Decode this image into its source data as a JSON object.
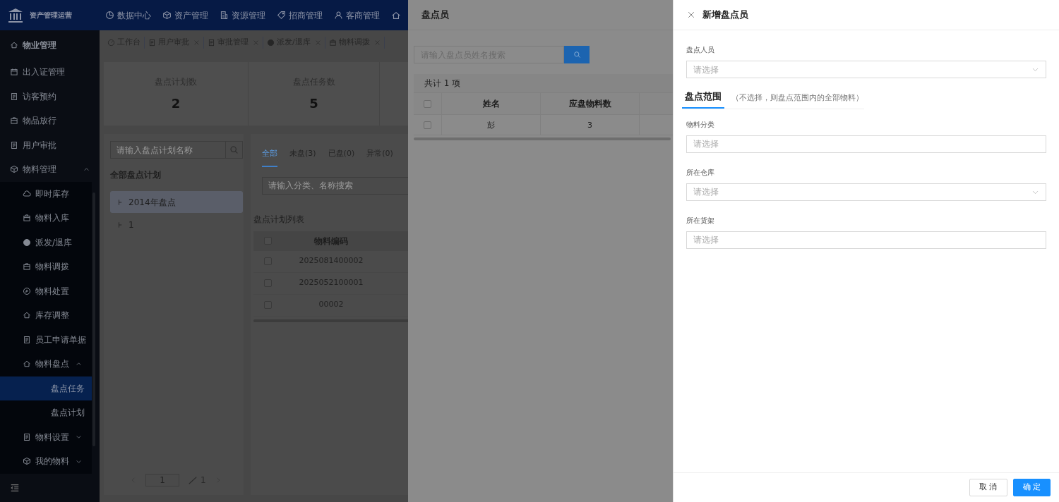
{
  "header": {
    "app_name": "资产管理运营",
    "nav": [
      {
        "label": "数据中心"
      },
      {
        "label": "资产管理"
      },
      {
        "label": "资源管理"
      },
      {
        "label": "招商管理"
      },
      {
        "label": "客商管理"
      }
    ]
  },
  "sidebar": {
    "items": [
      {
        "label": "物业管理",
        "selected": false
      },
      {
        "label": "出入证管理",
        "selected": false
      },
      {
        "label": "访客预约",
        "selected": false
      },
      {
        "label": "物品放行",
        "selected": false
      },
      {
        "label": "用户审批",
        "selected": false
      },
      {
        "label": "物料管理",
        "selected": false,
        "expanded": true,
        "children": [
          {
            "label": "即时库存",
            "selected": false
          },
          {
            "label": "物料入库",
            "selected": false
          },
          {
            "label": "派发/退库",
            "selected": false
          },
          {
            "label": "物料调拨",
            "selected": false
          },
          {
            "label": "物料处置",
            "selected": false
          },
          {
            "label": "库存调整",
            "selected": false
          },
          {
            "label": "员工申请单据",
            "selected": false
          },
          {
            "label": "物料盘点",
            "selected": false,
            "expanded": true,
            "children": [
              {
                "label": "盘点任务",
                "selected": true
              },
              {
                "label": "盘点计划",
                "selected": false
              }
            ]
          },
          {
            "label": "物料设置",
            "selected": false,
            "expanded": false
          },
          {
            "label": "我的物料",
            "selected": false,
            "expanded": false
          }
        ]
      }
    ]
  },
  "tabs": [
    {
      "label": "工作台",
      "closable": false
    },
    {
      "label": "用户审批",
      "closable": true
    },
    {
      "label": "审批管理",
      "closable": true
    },
    {
      "label": "派发/退库",
      "closable": true
    },
    {
      "label": "物料调拨",
      "closable": true
    }
  ],
  "stats": [
    {
      "label": "盘点计划数",
      "value": "2"
    },
    {
      "label": "盘点任务数",
      "value": "5"
    }
  ],
  "plan_panel": {
    "placeholder": "请输入盘点计划名称",
    "title": "全部盘点计划",
    "tree": [
      {
        "label": "2014年盘点",
        "selected": true
      },
      {
        "label": "1",
        "selected": false
      }
    ],
    "pager": {
      "page": "1",
      "total": "1"
    }
  },
  "task_panel": {
    "tabs": [
      {
        "label": "全部",
        "selected": true
      },
      {
        "label": "未盘(3)",
        "selected": false
      },
      {
        "label": "已盘(0)",
        "selected": false
      },
      {
        "label": "异常(0)",
        "selected": false
      }
    ],
    "placeholder": "请输入分类、名称搜索",
    "list_title": "盘点计划列表",
    "columns": [
      "物料编码"
    ],
    "all_checked": false,
    "rows": [
      {
        "code": "2025081400002",
        "checked": false
      },
      {
        "code": "2025052100001",
        "checked": false
      },
      {
        "code": "00002",
        "checked": false
      }
    ]
  },
  "counter_drawer": {
    "title": "盘点员",
    "placeholder": "请输入盘点员姓名搜索",
    "total": "共计 1 项",
    "columns": [
      "姓名",
      "应盘物料数"
    ],
    "all_checked": false,
    "rows": [
      {
        "cells": [
          "彭",
          "3"
        ],
        "checked": false
      }
    ]
  },
  "add_drawer": {
    "title": "新增盘点员",
    "fields": [
      {
        "label": "盘点人员",
        "placeholder": "请选择",
        "kind": "select"
      },
      {
        "kind": "section",
        "label": "盘点范围",
        "hint": "（不选择，则盘点范围内的全部物料）"
      },
      {
        "label": "物料分类",
        "placeholder": "请选择",
        "kind": "input"
      },
      {
        "label": "所在仓库",
        "placeholder": "请选择",
        "kind": "select"
      },
      {
        "label": "所在货架",
        "placeholder": "请选择",
        "kind": "input"
      }
    ],
    "buttons": [
      {
        "label": "取 消",
        "kind": "default"
      },
      {
        "label": "确 定",
        "kind": "primary"
      }
    ]
  }
}
